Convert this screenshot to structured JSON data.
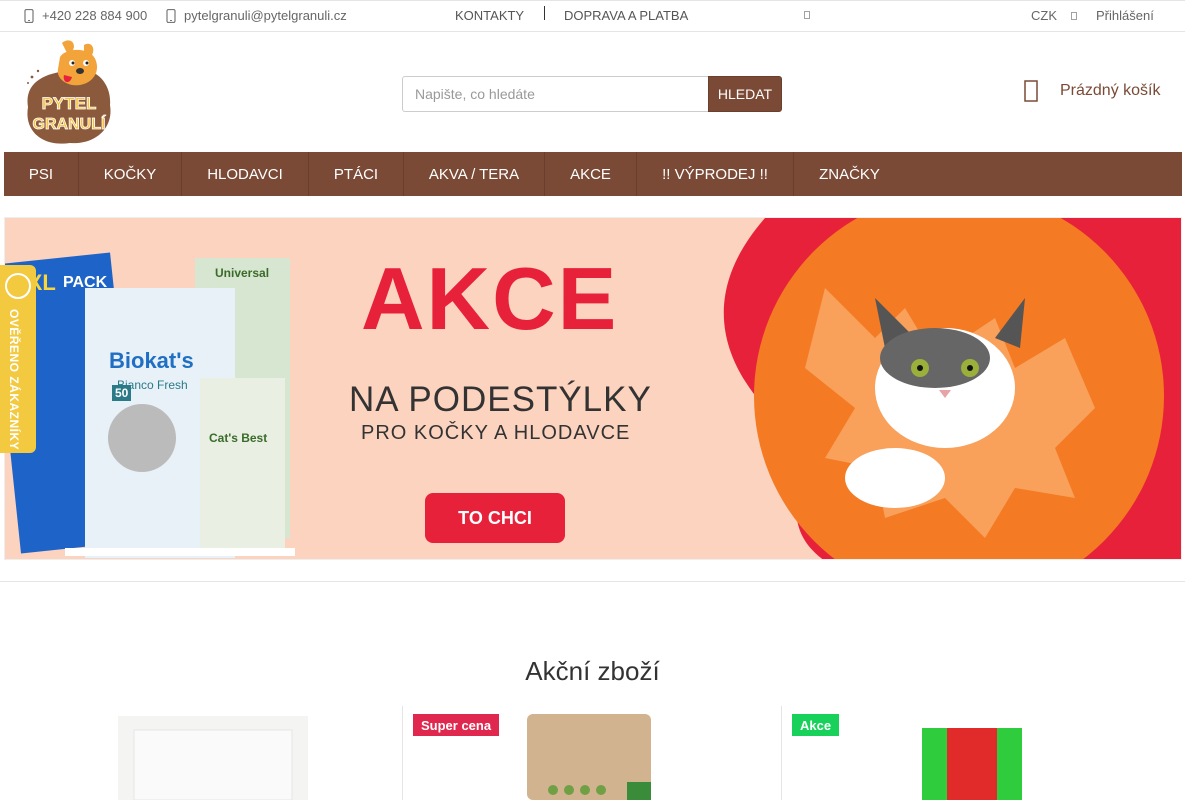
{
  "topbar": {
    "phone": "+420 228 884 900",
    "email": "pytelgranuli@pytelgranuli.cz",
    "links": [
      "KONTAKTY",
      "DOPRAVA A PLATBA"
    ],
    "currency": "CZK",
    "login": "Přihlášení"
  },
  "header": {
    "logo_text_top": "PYTEL",
    "logo_text_bottom": "GRANULÍ",
    "search_placeholder": "Napište, co hledáte",
    "search_button": "HLEDAT",
    "cart_label": "Prázdný košík"
  },
  "nav": {
    "items": [
      "PSI",
      "KOČKY",
      "HLODAVCI",
      "PTÁCI",
      "AKVA / TERA",
      "AKCE",
      "!! VÝPRODEJ !!",
      "ZNAČKY"
    ]
  },
  "banner": {
    "headline": "AKCE",
    "line1": "NA PODESTÝLKY",
    "line2": "PRO KOČKY A HLODAVCE",
    "cta": "TO CHCI",
    "packs": {
      "xxl": "XXL",
      "pack": "PACK",
      "brand1": "Biokat's",
      "brand1_sub": "Bianco Fresh",
      "brand2": "Cat's Best",
      "brand2_sub": "Universal",
      "percent": "50"
    }
  },
  "side_badge": {
    "label": "OVĚŘENO ZÁKAZNÍKY"
  },
  "section": {
    "title": "Akční zboží"
  },
  "products": [
    {
      "badge": ""
    },
    {
      "badge": "Super cena",
      "badge_color": "#e0284e"
    },
    {
      "badge": "Akce",
      "badge_color": "#18d15a"
    }
  ],
  "colors": {
    "brand": "#7a4a36",
    "banner_bg": "#fcd3bf",
    "banner_red": "#e8213a",
    "blob_orange": "#f47a23",
    "side_badge": "#f3c940"
  }
}
